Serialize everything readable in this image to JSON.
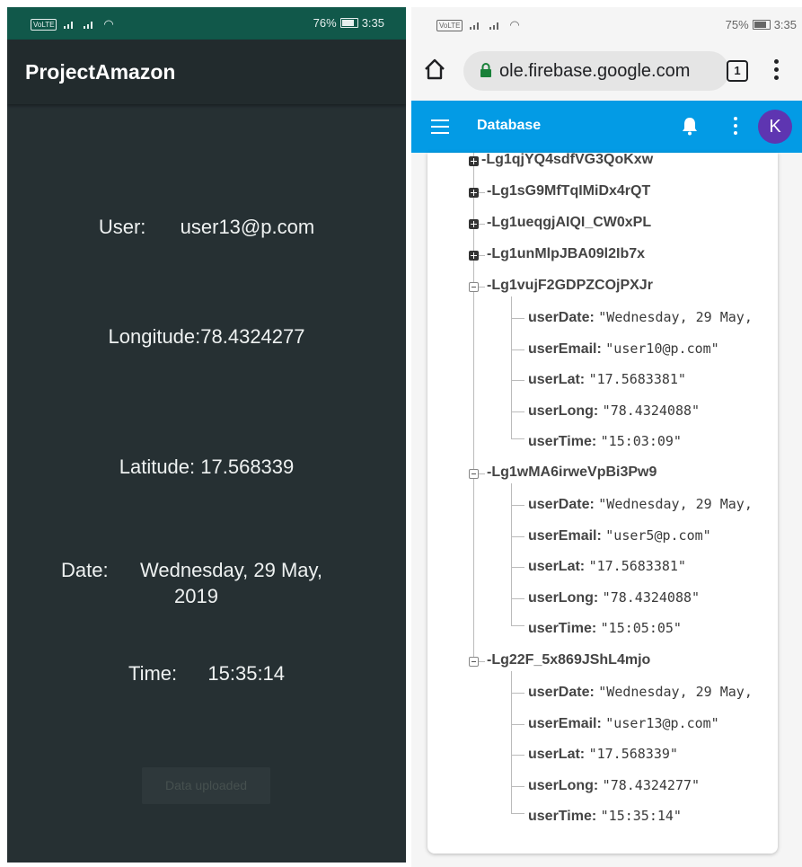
{
  "left_phone": {
    "status": {
      "network_badge": "VoLTE",
      "battery": "76%",
      "time": "3:35"
    },
    "app_title": "ProjectAmazon",
    "user": {
      "label": "User:",
      "value": "user13@p.com"
    },
    "longitude": {
      "label": "Longitude:",
      "value": "78.4324277"
    },
    "latitude": {
      "label": "Latitude:",
      "value": "17.568339"
    },
    "date": {
      "label": "Date:",
      "value_line1": "Wednesday, 29 May,",
      "value_line2": "2019"
    },
    "time": {
      "label": "Time:",
      "value": "15:35:14"
    },
    "upload_button": "Data uploaded"
  },
  "right_phone": {
    "status": {
      "network_badge": "VoLTE",
      "battery": "75%",
      "time": "3:35"
    },
    "browser": {
      "url": "ole.firebase.google.com",
      "tab_count": "1"
    },
    "firebase": {
      "title": "Database",
      "avatar_letter": "K"
    },
    "tree": {
      "collapsed_nodes": [
        "-Lg1qjYQ4sdfVG3QoKxw",
        "-Lg1sG9MfTqIMiDx4rQT",
        "-Lg1ueqgjAIQI_CW0xPL",
        "-Lg1unMlpJBA09l2Ib7x"
      ],
      "expanded_nodes": [
        {
          "key": "-Lg1vujF2GDPZCOjPXJr",
          "fields": [
            {
              "key": "userDate:",
              "value": "\"Wednesday, 29 May,"
            },
            {
              "key": "userEmail:",
              "value": "\"user10@p.com\""
            },
            {
              "key": "userLat:",
              "value": "\"17.5683381\""
            },
            {
              "key": "userLong:",
              "value": "\"78.4324088\""
            },
            {
              "key": "userTime:",
              "value": "\"15:03:09\""
            }
          ]
        },
        {
          "key": "-Lg1wMA6irweVpBi3Pw9",
          "fields": [
            {
              "key": "userDate:",
              "value": "\"Wednesday, 29 May,"
            },
            {
              "key": "userEmail:",
              "value": "\"user5@p.com\""
            },
            {
              "key": "userLat:",
              "value": "\"17.5683381\""
            },
            {
              "key": "userLong:",
              "value": "\"78.4324088\""
            },
            {
              "key": "userTime:",
              "value": "\"15:05:05\""
            }
          ]
        },
        {
          "key": "-Lg22F_5x869JShL4mjo",
          "fields": [
            {
              "key": "userDate:",
              "value": "\"Wednesday, 29 May,"
            },
            {
              "key": "userEmail:",
              "value": "\"user13@p.com\""
            },
            {
              "key": "userLat:",
              "value": "\"17.568339\""
            },
            {
              "key": "userLong:",
              "value": "\"78.4324277\""
            },
            {
              "key": "userTime:",
              "value": "\"15:35:14\""
            }
          ]
        }
      ]
    }
  },
  "colors": {
    "left_status_bar": "#11584a",
    "left_background": "#263033",
    "firebase_blue": "#039be5",
    "avatar_purple": "#5e35b1"
  }
}
